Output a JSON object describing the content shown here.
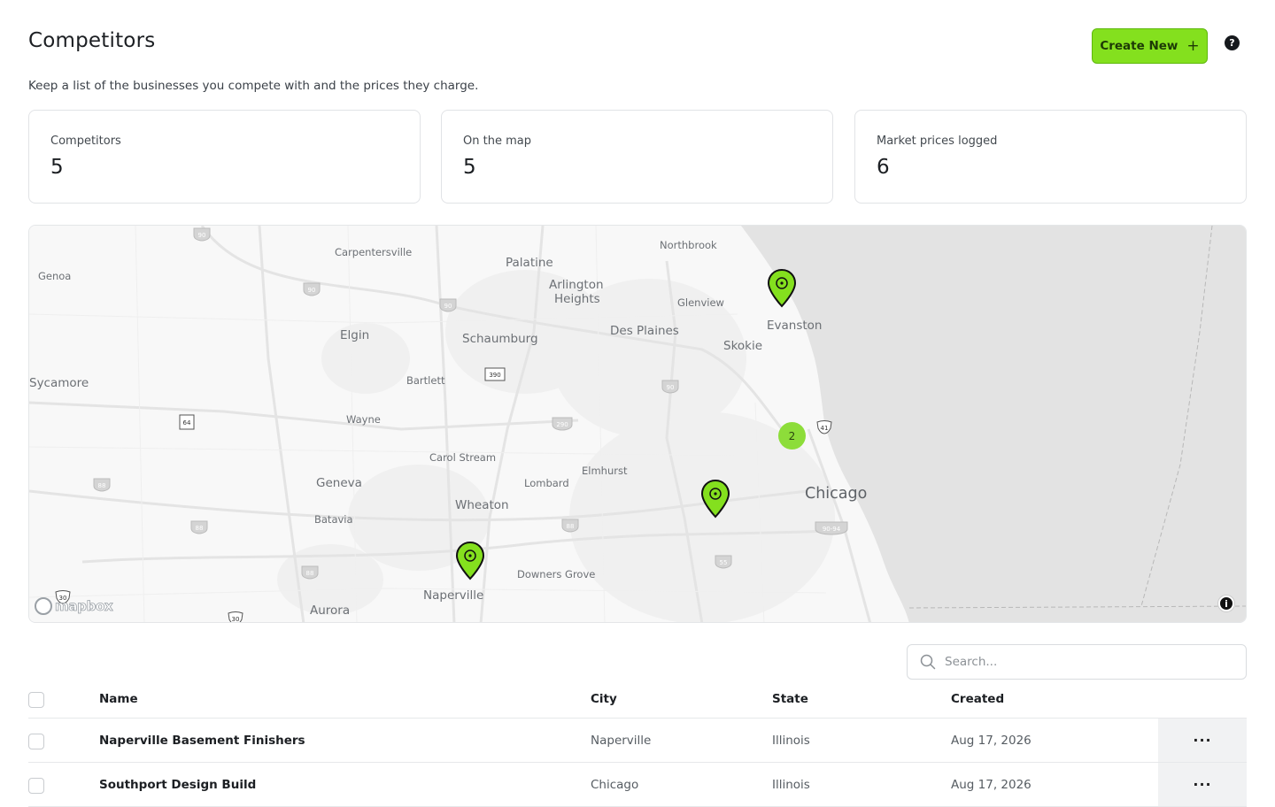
{
  "header": {
    "title": "Competitors",
    "create_label": "Create New",
    "create_icon": "+",
    "help_icon": "?",
    "subtitle": "Keep a list of the businesses you compete with and the prices they charge."
  },
  "stats": [
    {
      "label": "Competitors",
      "value": "5"
    },
    {
      "label": "On the map",
      "value": "5"
    },
    {
      "label": "Market prices logged",
      "value": "6"
    }
  ],
  "map": {
    "cities": [
      "Genoa",
      "Carpentersville",
      "Palatine",
      "Northbrook",
      "Arlington",
      "Heights",
      "Glenview",
      "Elgin",
      "Schaumburg",
      "Des Plaines",
      "Evanston",
      "Skokie",
      "Sycamore",
      "Bartlett",
      "Wayne",
      "Carol Stream",
      "Elmhurst",
      "Geneva",
      "Lombard",
      "Wheaton",
      "Chicago",
      "Batavia",
      "Naperville",
      "Downers Grove",
      "Aurora"
    ],
    "shields": [
      "90",
      "90",
      "90",
      "390",
      "90",
      "64",
      "290",
      "41",
      "88",
      "88",
      "88",
      "88",
      "90-94",
      "55",
      "88",
      "30",
      "30"
    ],
    "cluster_count": "2",
    "attribution": "mapbox",
    "info_icon": "i",
    "pin_color": "#84e01e",
    "water_color": "#e3e3e3"
  },
  "search": {
    "placeholder": "Search..."
  },
  "table": {
    "columns": [
      "Name",
      "City",
      "State",
      "Created"
    ],
    "rows": [
      {
        "name": "Naperville Basement Finishers",
        "city": "Naperville",
        "state": "Illinois",
        "created": "Aug 17, 2026"
      },
      {
        "name": "Southport Design Build",
        "city": "Chicago",
        "state": "Illinois",
        "created": "Aug 17, 2026"
      }
    ],
    "actions_icon": "···"
  }
}
